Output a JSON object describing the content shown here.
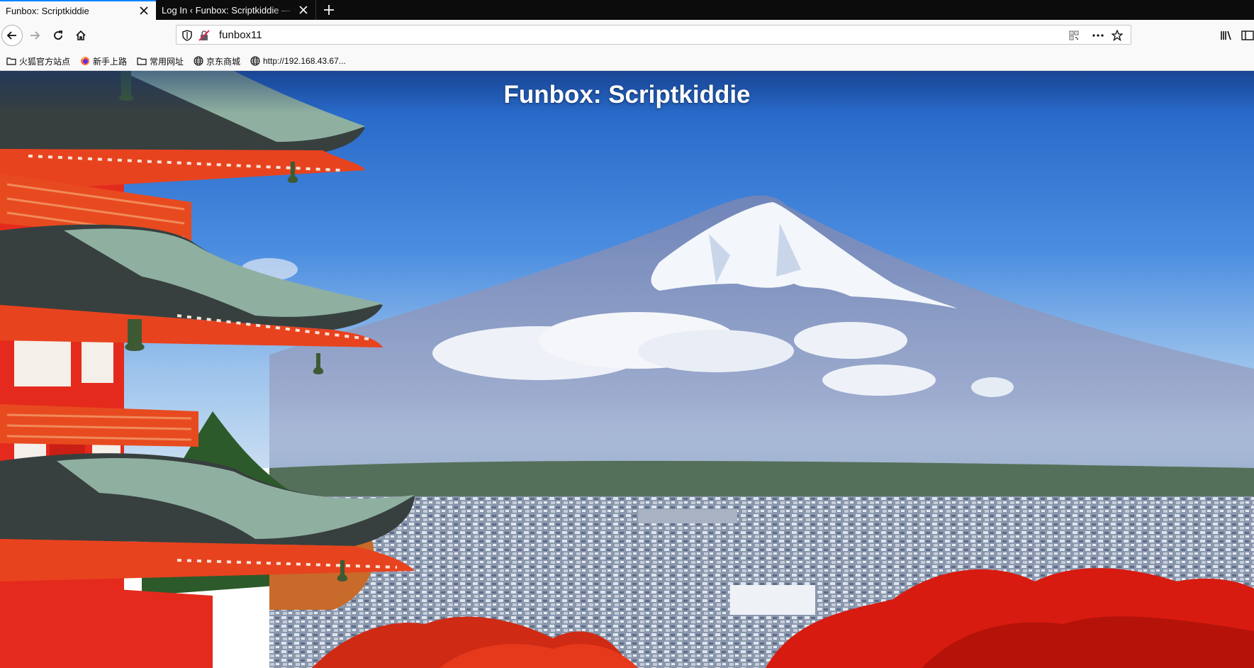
{
  "tabs": [
    {
      "title": "Funbox: Scriptkiddie",
      "active": true,
      "close_icon": "close-icon"
    },
    {
      "title": "Log In ‹ Funbox: Scriptkiddie — WordPress",
      "active": false,
      "close_icon": "close-icon"
    }
  ],
  "navbar": {
    "url": "funbox11",
    "icons": [
      "back-arrow-icon",
      "forward-arrow-icon",
      "reload-icon",
      "home-icon",
      "shield-icon",
      "insecure-lock-icon",
      "qr-code-icon",
      "more-dots-icon",
      "bookmark-star-icon",
      "library-icon",
      "sidebar-icon"
    ]
  },
  "bookmarks": [
    {
      "label": "火狐官方站点",
      "icon": "folder-icon"
    },
    {
      "label": "新手上路",
      "icon": "firefox-icon"
    },
    {
      "label": "常用网址",
      "icon": "folder-icon"
    },
    {
      "label": "京东商城",
      "icon": "globe-icon"
    },
    {
      "label": "http://192.168.43.67...",
      "icon": "globe-icon"
    }
  ],
  "page": {
    "title": "Funbox: Scriptkiddie",
    "background": "Mount Fuji with snow-capped peak, red pagoda, red autumn foliage, town below"
  },
  "colors": {
    "tab_accent": "#0a84ff",
    "sky": "#3a7fd6",
    "pagoda_red": "#e42a1d",
    "foliage_red": "#d91c10"
  }
}
